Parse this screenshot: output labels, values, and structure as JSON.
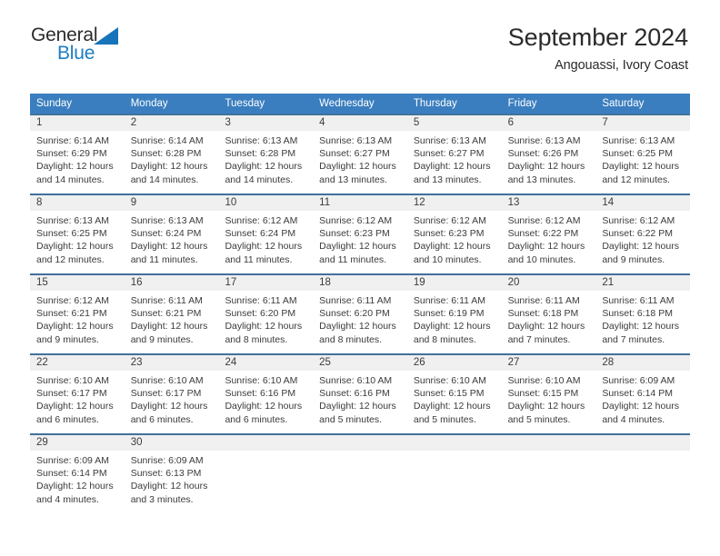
{
  "logo": {
    "text_general": "General",
    "text_blue": "Blue",
    "color_blue": "#1b7ec2",
    "color_general": "#2b2b2b"
  },
  "header": {
    "title": "September 2024",
    "subtitle": "Angouassi, Ivory Coast"
  },
  "theme": {
    "header_row_bg": "#3a7ebf",
    "row_divider": "#41719c",
    "day_band_bg": "#f0f0f0",
    "text": "#3b3b3b"
  },
  "weekdays": [
    "Sunday",
    "Monday",
    "Tuesday",
    "Wednesday",
    "Thursday",
    "Friday",
    "Saturday"
  ],
  "weeks": [
    [
      {
        "day": "1",
        "sunrise": "Sunrise: 6:14 AM",
        "sunset": "Sunset: 6:29 PM",
        "daylight1": "Daylight: 12 hours",
        "daylight2": "and 14 minutes."
      },
      {
        "day": "2",
        "sunrise": "Sunrise: 6:14 AM",
        "sunset": "Sunset: 6:28 PM",
        "daylight1": "Daylight: 12 hours",
        "daylight2": "and 14 minutes."
      },
      {
        "day": "3",
        "sunrise": "Sunrise: 6:13 AM",
        "sunset": "Sunset: 6:28 PM",
        "daylight1": "Daylight: 12 hours",
        "daylight2": "and 14 minutes."
      },
      {
        "day": "4",
        "sunrise": "Sunrise: 6:13 AM",
        "sunset": "Sunset: 6:27 PM",
        "daylight1": "Daylight: 12 hours",
        "daylight2": "and 13 minutes."
      },
      {
        "day": "5",
        "sunrise": "Sunrise: 6:13 AM",
        "sunset": "Sunset: 6:27 PM",
        "daylight1": "Daylight: 12 hours",
        "daylight2": "and 13 minutes."
      },
      {
        "day": "6",
        "sunrise": "Sunrise: 6:13 AM",
        "sunset": "Sunset: 6:26 PM",
        "daylight1": "Daylight: 12 hours",
        "daylight2": "and 13 minutes."
      },
      {
        "day": "7",
        "sunrise": "Sunrise: 6:13 AM",
        "sunset": "Sunset: 6:25 PM",
        "daylight1": "Daylight: 12 hours",
        "daylight2": "and 12 minutes."
      }
    ],
    [
      {
        "day": "8",
        "sunrise": "Sunrise: 6:13 AM",
        "sunset": "Sunset: 6:25 PM",
        "daylight1": "Daylight: 12 hours",
        "daylight2": "and 12 minutes."
      },
      {
        "day": "9",
        "sunrise": "Sunrise: 6:13 AM",
        "sunset": "Sunset: 6:24 PM",
        "daylight1": "Daylight: 12 hours",
        "daylight2": "and 11 minutes."
      },
      {
        "day": "10",
        "sunrise": "Sunrise: 6:12 AM",
        "sunset": "Sunset: 6:24 PM",
        "daylight1": "Daylight: 12 hours",
        "daylight2": "and 11 minutes."
      },
      {
        "day": "11",
        "sunrise": "Sunrise: 6:12 AM",
        "sunset": "Sunset: 6:23 PM",
        "daylight1": "Daylight: 12 hours",
        "daylight2": "and 11 minutes."
      },
      {
        "day": "12",
        "sunrise": "Sunrise: 6:12 AM",
        "sunset": "Sunset: 6:23 PM",
        "daylight1": "Daylight: 12 hours",
        "daylight2": "and 10 minutes."
      },
      {
        "day": "13",
        "sunrise": "Sunrise: 6:12 AM",
        "sunset": "Sunset: 6:22 PM",
        "daylight1": "Daylight: 12 hours",
        "daylight2": "and 10 minutes."
      },
      {
        "day": "14",
        "sunrise": "Sunrise: 6:12 AM",
        "sunset": "Sunset: 6:22 PM",
        "daylight1": "Daylight: 12 hours",
        "daylight2": "and 9 minutes."
      }
    ],
    [
      {
        "day": "15",
        "sunrise": "Sunrise: 6:12 AM",
        "sunset": "Sunset: 6:21 PM",
        "daylight1": "Daylight: 12 hours",
        "daylight2": "and 9 minutes."
      },
      {
        "day": "16",
        "sunrise": "Sunrise: 6:11 AM",
        "sunset": "Sunset: 6:21 PM",
        "daylight1": "Daylight: 12 hours",
        "daylight2": "and 9 minutes."
      },
      {
        "day": "17",
        "sunrise": "Sunrise: 6:11 AM",
        "sunset": "Sunset: 6:20 PM",
        "daylight1": "Daylight: 12 hours",
        "daylight2": "and 8 minutes."
      },
      {
        "day": "18",
        "sunrise": "Sunrise: 6:11 AM",
        "sunset": "Sunset: 6:20 PM",
        "daylight1": "Daylight: 12 hours",
        "daylight2": "and 8 minutes."
      },
      {
        "day": "19",
        "sunrise": "Sunrise: 6:11 AM",
        "sunset": "Sunset: 6:19 PM",
        "daylight1": "Daylight: 12 hours",
        "daylight2": "and 8 minutes."
      },
      {
        "day": "20",
        "sunrise": "Sunrise: 6:11 AM",
        "sunset": "Sunset: 6:18 PM",
        "daylight1": "Daylight: 12 hours",
        "daylight2": "and 7 minutes."
      },
      {
        "day": "21",
        "sunrise": "Sunrise: 6:11 AM",
        "sunset": "Sunset: 6:18 PM",
        "daylight1": "Daylight: 12 hours",
        "daylight2": "and 7 minutes."
      }
    ],
    [
      {
        "day": "22",
        "sunrise": "Sunrise: 6:10 AM",
        "sunset": "Sunset: 6:17 PM",
        "daylight1": "Daylight: 12 hours",
        "daylight2": "and 6 minutes."
      },
      {
        "day": "23",
        "sunrise": "Sunrise: 6:10 AM",
        "sunset": "Sunset: 6:17 PM",
        "daylight1": "Daylight: 12 hours",
        "daylight2": "and 6 minutes."
      },
      {
        "day": "24",
        "sunrise": "Sunrise: 6:10 AM",
        "sunset": "Sunset: 6:16 PM",
        "daylight1": "Daylight: 12 hours",
        "daylight2": "and 6 minutes."
      },
      {
        "day": "25",
        "sunrise": "Sunrise: 6:10 AM",
        "sunset": "Sunset: 6:16 PM",
        "daylight1": "Daylight: 12 hours",
        "daylight2": "and 5 minutes."
      },
      {
        "day": "26",
        "sunrise": "Sunrise: 6:10 AM",
        "sunset": "Sunset: 6:15 PM",
        "daylight1": "Daylight: 12 hours",
        "daylight2": "and 5 minutes."
      },
      {
        "day": "27",
        "sunrise": "Sunrise: 6:10 AM",
        "sunset": "Sunset: 6:15 PM",
        "daylight1": "Daylight: 12 hours",
        "daylight2": "and 5 minutes."
      },
      {
        "day": "28",
        "sunrise": "Sunrise: 6:09 AM",
        "sunset": "Sunset: 6:14 PM",
        "daylight1": "Daylight: 12 hours",
        "daylight2": "and 4 minutes."
      }
    ],
    [
      {
        "day": "29",
        "sunrise": "Sunrise: 6:09 AM",
        "sunset": "Sunset: 6:14 PM",
        "daylight1": "Daylight: 12 hours",
        "daylight2": "and 4 minutes."
      },
      {
        "day": "30",
        "sunrise": "Sunrise: 6:09 AM",
        "sunset": "Sunset: 6:13 PM",
        "daylight1": "Daylight: 12 hours",
        "daylight2": "and 3 minutes."
      },
      {
        "day": "",
        "sunrise": "",
        "sunset": "",
        "daylight1": "",
        "daylight2": ""
      },
      {
        "day": "",
        "sunrise": "",
        "sunset": "",
        "daylight1": "",
        "daylight2": ""
      },
      {
        "day": "",
        "sunrise": "",
        "sunset": "",
        "daylight1": "",
        "daylight2": ""
      },
      {
        "day": "",
        "sunrise": "",
        "sunset": "",
        "daylight1": "",
        "daylight2": ""
      },
      {
        "day": "",
        "sunrise": "",
        "sunset": "",
        "daylight1": "",
        "daylight2": ""
      }
    ]
  ]
}
